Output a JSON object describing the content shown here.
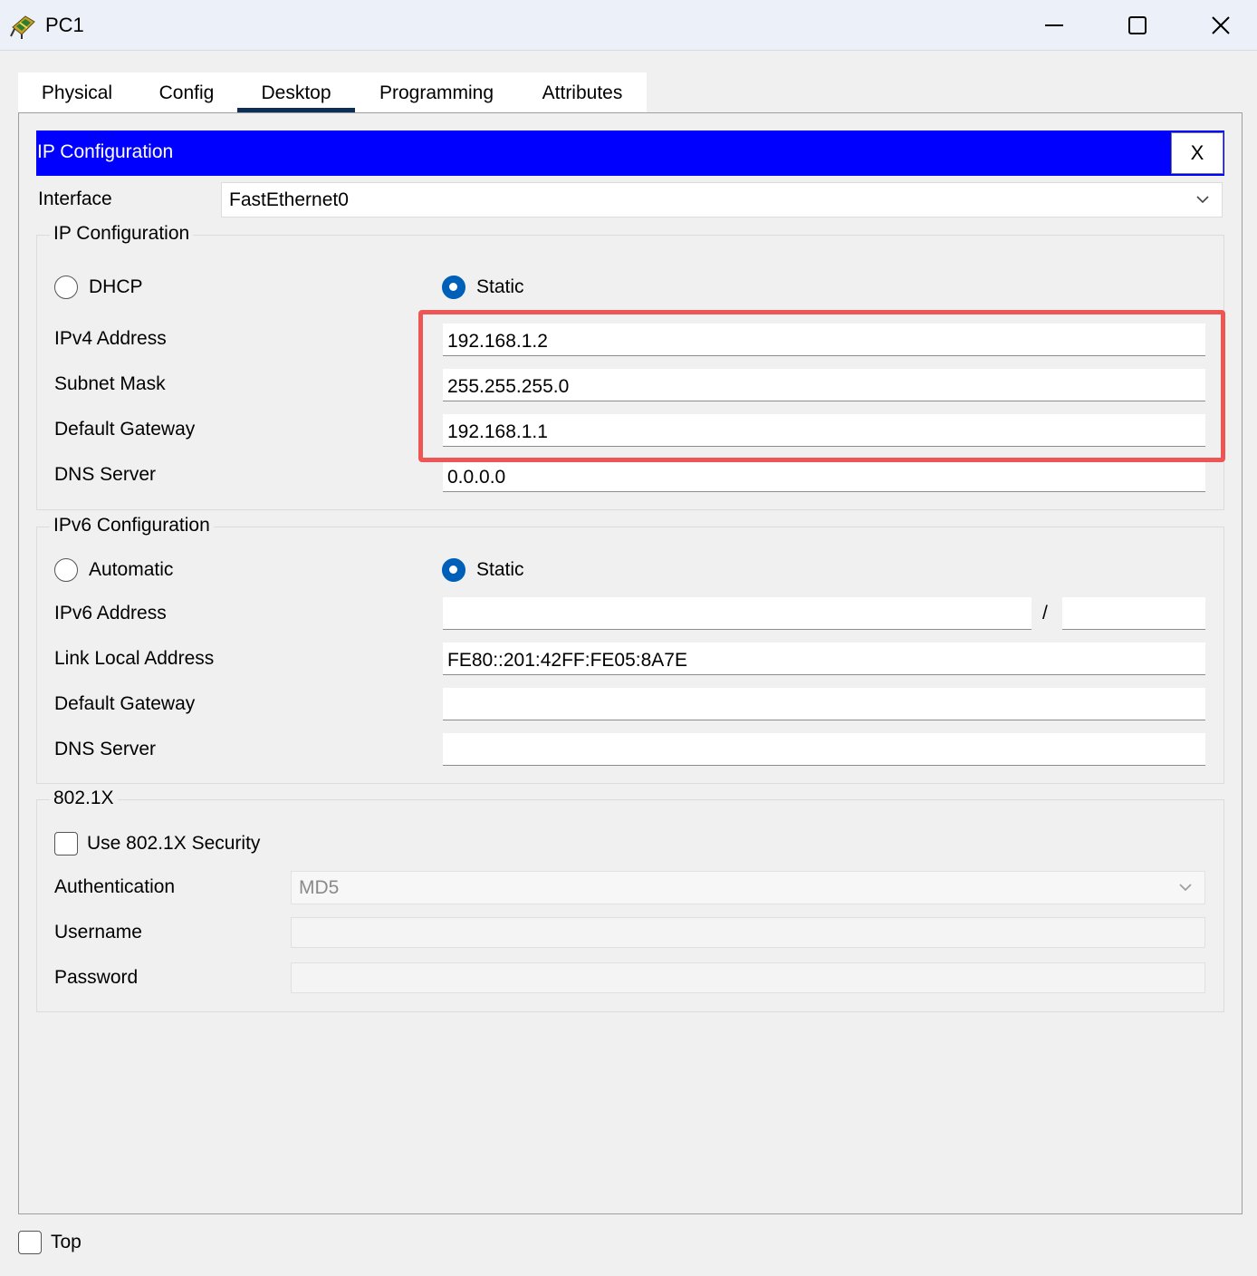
{
  "window": {
    "title": "PC1",
    "app_icon": "packet-tracer-pc-icon",
    "controls": {
      "minimize_icon": "minimize-icon",
      "maximize_icon": "maximize-icon",
      "close_icon": "close-icon"
    }
  },
  "tabs": [
    {
      "label": "Physical",
      "active": false
    },
    {
      "label": "Config",
      "active": false
    },
    {
      "label": "Desktop",
      "active": true
    },
    {
      "label": "Programming",
      "active": false
    },
    {
      "label": "Attributes",
      "active": false
    }
  ],
  "ip_config_window": {
    "title": "IP Configuration",
    "close_label": "X",
    "title_bar_color": "#0000ff"
  },
  "interface": {
    "label": "Interface",
    "value": "FastEthernet0"
  },
  "ipv4": {
    "group_title": "IP Configuration",
    "dhcp_label": "DHCP",
    "static_label": "Static",
    "mode": "Static",
    "address_label": "IPv4 Address",
    "address": "192.168.1.2",
    "mask_label": "Subnet Mask",
    "mask": "255.255.255.0",
    "gateway_label": "Default Gateway",
    "gateway": "192.168.1.1",
    "dns_label": "DNS Server",
    "dns": "0.0.0.0"
  },
  "ipv6": {
    "group_title": "IPv6 Configuration",
    "automatic_label": "Automatic",
    "static_label": "Static",
    "mode": "Static",
    "address_label": "IPv6 Address",
    "address": "",
    "prefix_separator": "/",
    "prefix": "",
    "link_local_label": "Link Local Address",
    "link_local": "FE80::201:42FF:FE05:8A7E",
    "gateway_label": "Default Gateway",
    "gateway": "",
    "dns_label": "DNS Server",
    "dns": ""
  },
  "dot1x": {
    "group_title": "802.1X",
    "use_security_label": "Use 802.1X Security",
    "use_security": false,
    "auth_label": "Authentication",
    "auth_value": "MD5",
    "username_label": "Username",
    "username": "",
    "password_label": "Password",
    "password": ""
  },
  "footer": {
    "top_label": "Top",
    "top_checked": false
  },
  "colors": {
    "highlight": "#ee5555",
    "radio_selected": "#005fb8",
    "active_tab_underline": "#0d2f55"
  }
}
